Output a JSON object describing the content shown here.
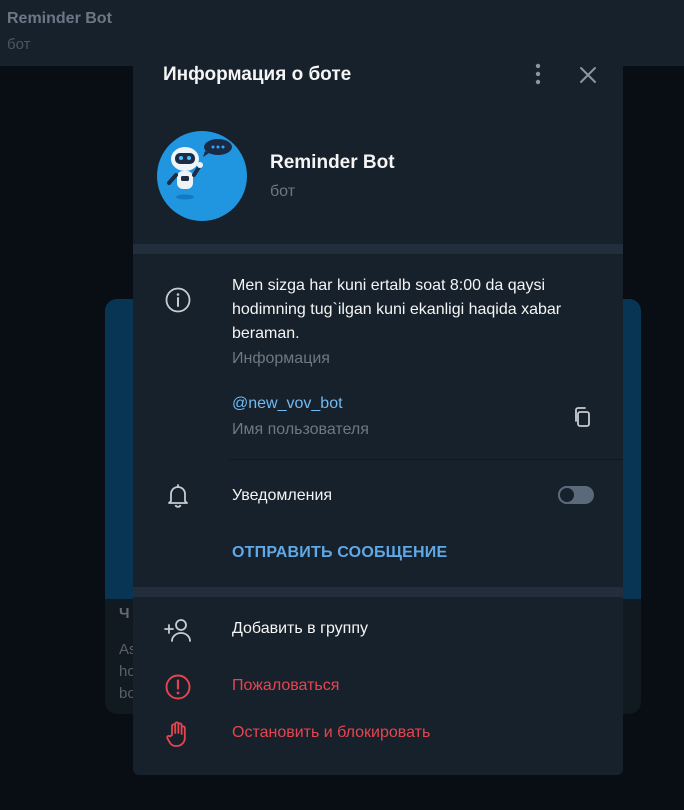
{
  "background": {
    "chat_title": "Reminder Bot",
    "chat_subtitle": "бот",
    "card_title_partial": "Ч",
    "card_text_partial": "As ho bo"
  },
  "dialog": {
    "title": "Информация о боте",
    "bot_name": "Reminder Bot",
    "bot_type": "бот",
    "description": "Men sizga har kuni ertalb soat 8:00 da qaysi hodimning tug`ilgan kuni ekanligi haqida xabar beraman.",
    "description_label": "Информация",
    "username": "@new_vov_bot",
    "username_label": "Имя пользователя",
    "notifications_label": "Уведомления",
    "notifications_enabled": false,
    "send_message_label": "ОТПРАВИТЬ СООБЩЕНИЕ",
    "add_to_group_label": "Добавить в группу",
    "report_label": "Пожаловаться",
    "block_label": "Остановить и блокировать"
  },
  "colors": {
    "dialog_bg": "#17212b",
    "accent": "#5fa9e8",
    "link": "#71baf2",
    "danger": "#e5454f",
    "muted": "#6c7883"
  }
}
